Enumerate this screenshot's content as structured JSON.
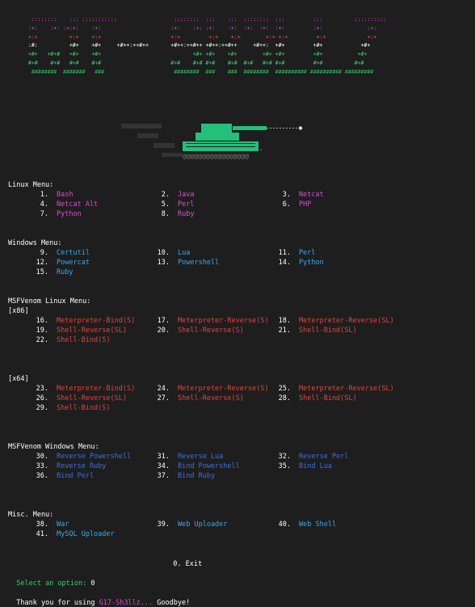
{
  "banner": {
    "rows": [
      {
        "cls": "b-pink",
        "text": "  ::::::::    ::: :::::::::::                  ::::::::  :::    :::  ::::::::  :::         :::          ::::::::::"
      },
      {
        "cls": "b-pink",
        "text": " :+:    :+: :+:+:    :+:                      :+:    :+: :+:    :+:  :+:  :+:  :+:         :+:              :+:"
      },
      {
        "cls": "b-red",
        "text": " +:+          +:+    +:+                      +:+         +:+    +:+        +:+ +:+         +:+             +:+"
      },
      {
        "cls": "b-white",
        "text": " :#:          +#+    +#+     +#++:++#++       +#++:++#++ +#++:++#++     +#++:  +#+         +#+            +#+"
      },
      {
        "cls": "b-green",
        "text": " +#+   +#+#   +#+    +#+                             +#+ +#+    +#+        +#+ +#+         +#+           +#+"
      },
      {
        "cls": "b-green",
        "text": " #+#    #+#   #+#    #+#                      #+#    #+# #+#    #+#  #+#   #+# #+#         #+#          #+#"
      },
      {
        "cls": "b-dgreen",
        "text": "  ########  #######   ###                      ########  ###    ###  ########  ########## ########## #########"
      }
    ]
  },
  "linux_menu": {
    "title": "Linux Menu:",
    "items": [
      {
        "num": "1.",
        "label": "Bash"
      },
      {
        "num": "2.",
        "label": "Java"
      },
      {
        "num": "3.",
        "label": "Netcat"
      },
      {
        "num": "4.",
        "label": "Netcat Alt"
      },
      {
        "num": "5.",
        "label": "Perl"
      },
      {
        "num": "6.",
        "label": "PHP"
      },
      {
        "num": "7.",
        "label": "Python"
      },
      {
        "num": "8.",
        "label": "Ruby"
      }
    ]
  },
  "windows_menu": {
    "title": "Windows Menu:",
    "items": [
      {
        "num": "9.",
        "label": "Certutil"
      },
      {
        "num": "10.",
        "label": "Lua"
      },
      {
        "num": "11.",
        "label": "Perl"
      },
      {
        "num": "12.",
        "label": "Powercat"
      },
      {
        "num": "13.",
        "label": "Powershell"
      },
      {
        "num": "14.",
        "label": "Python"
      },
      {
        "num": "15.",
        "label": "Ruby"
      }
    ]
  },
  "msf_linux_menu": {
    "title": "MSFVenom Linux Menu:",
    "x86_label": "[x86]",
    "x86": [
      {
        "num": "16.",
        "label": "Meterpreter-Bind(S)"
      },
      {
        "num": "17.",
        "label": "Meterpreter-Reverse(S)"
      },
      {
        "num": "18.",
        "label": "Meterpreter-Reverse(SL)"
      },
      {
        "num": "19.",
        "label": "Shell-Reverse(SL)"
      },
      {
        "num": "20.",
        "label": "Shell-Reverse(S)"
      },
      {
        "num": "21.",
        "label": "Shell-Bind(SL)"
      },
      {
        "num": "22.",
        "label": "Shell-Bind(S)"
      }
    ],
    "x64_label": "[x64]",
    "x64": [
      {
        "num": "23.",
        "label": "Meterpreter-Bind(S)"
      },
      {
        "num": "24.",
        "label": "Meterpreter-Reverse(S)"
      },
      {
        "num": "25.",
        "label": "Meterpreter-Reverse(SL)"
      },
      {
        "num": "26.",
        "label": "Shell-Reverse(SL)"
      },
      {
        "num": "27.",
        "label": "Shell-Reverse(S)"
      },
      {
        "num": "28.",
        "label": "Shell-Bind(SL)"
      },
      {
        "num": "29.",
        "label": "Shell-Bind(S)"
      }
    ]
  },
  "msf_windows_menu": {
    "title": "MSFVenom Windows Menu:",
    "items": [
      {
        "num": "30.",
        "label": "Reverse Powershell"
      },
      {
        "num": "31.",
        "label": "Reverse Lua"
      },
      {
        "num": "32.",
        "label": "Reverse Perl"
      },
      {
        "num": "33.",
        "label": "Reverse Ruby"
      },
      {
        "num": "34.",
        "label": "Bind Powershell"
      },
      {
        "num": "35.",
        "label": "Bind Lua"
      },
      {
        "num": "36.",
        "label": "Bind Perl"
      },
      {
        "num": "37.",
        "label": "Bind Ruby"
      }
    ]
  },
  "misc_menu": {
    "title": "Misc. Menu:",
    "items": [
      {
        "num": "38.",
        "label": "War"
      },
      {
        "num": "39.",
        "label": "Web Uploader"
      },
      {
        "num": "40.",
        "label": "Web Shell"
      },
      {
        "num": "41.",
        "label": "MySQL Uploader"
      }
    ]
  },
  "exit": {
    "num": "0.",
    "label": "Exit"
  },
  "prompt": {
    "label": "Select an option:",
    "value": "0"
  },
  "goodbye": {
    "prefix": "Thank you for using ",
    "name": "G17-Sh3llz...",
    "suffix": " Goodbye!"
  },
  "colors": {
    "background": "#1e1e1e",
    "linux": "#d94fd0",
    "windows": "#3ea8e6",
    "msf_linux": "#e0453f",
    "msf_windows": "#3a6fe6",
    "prompt": "#33d26a"
  }
}
